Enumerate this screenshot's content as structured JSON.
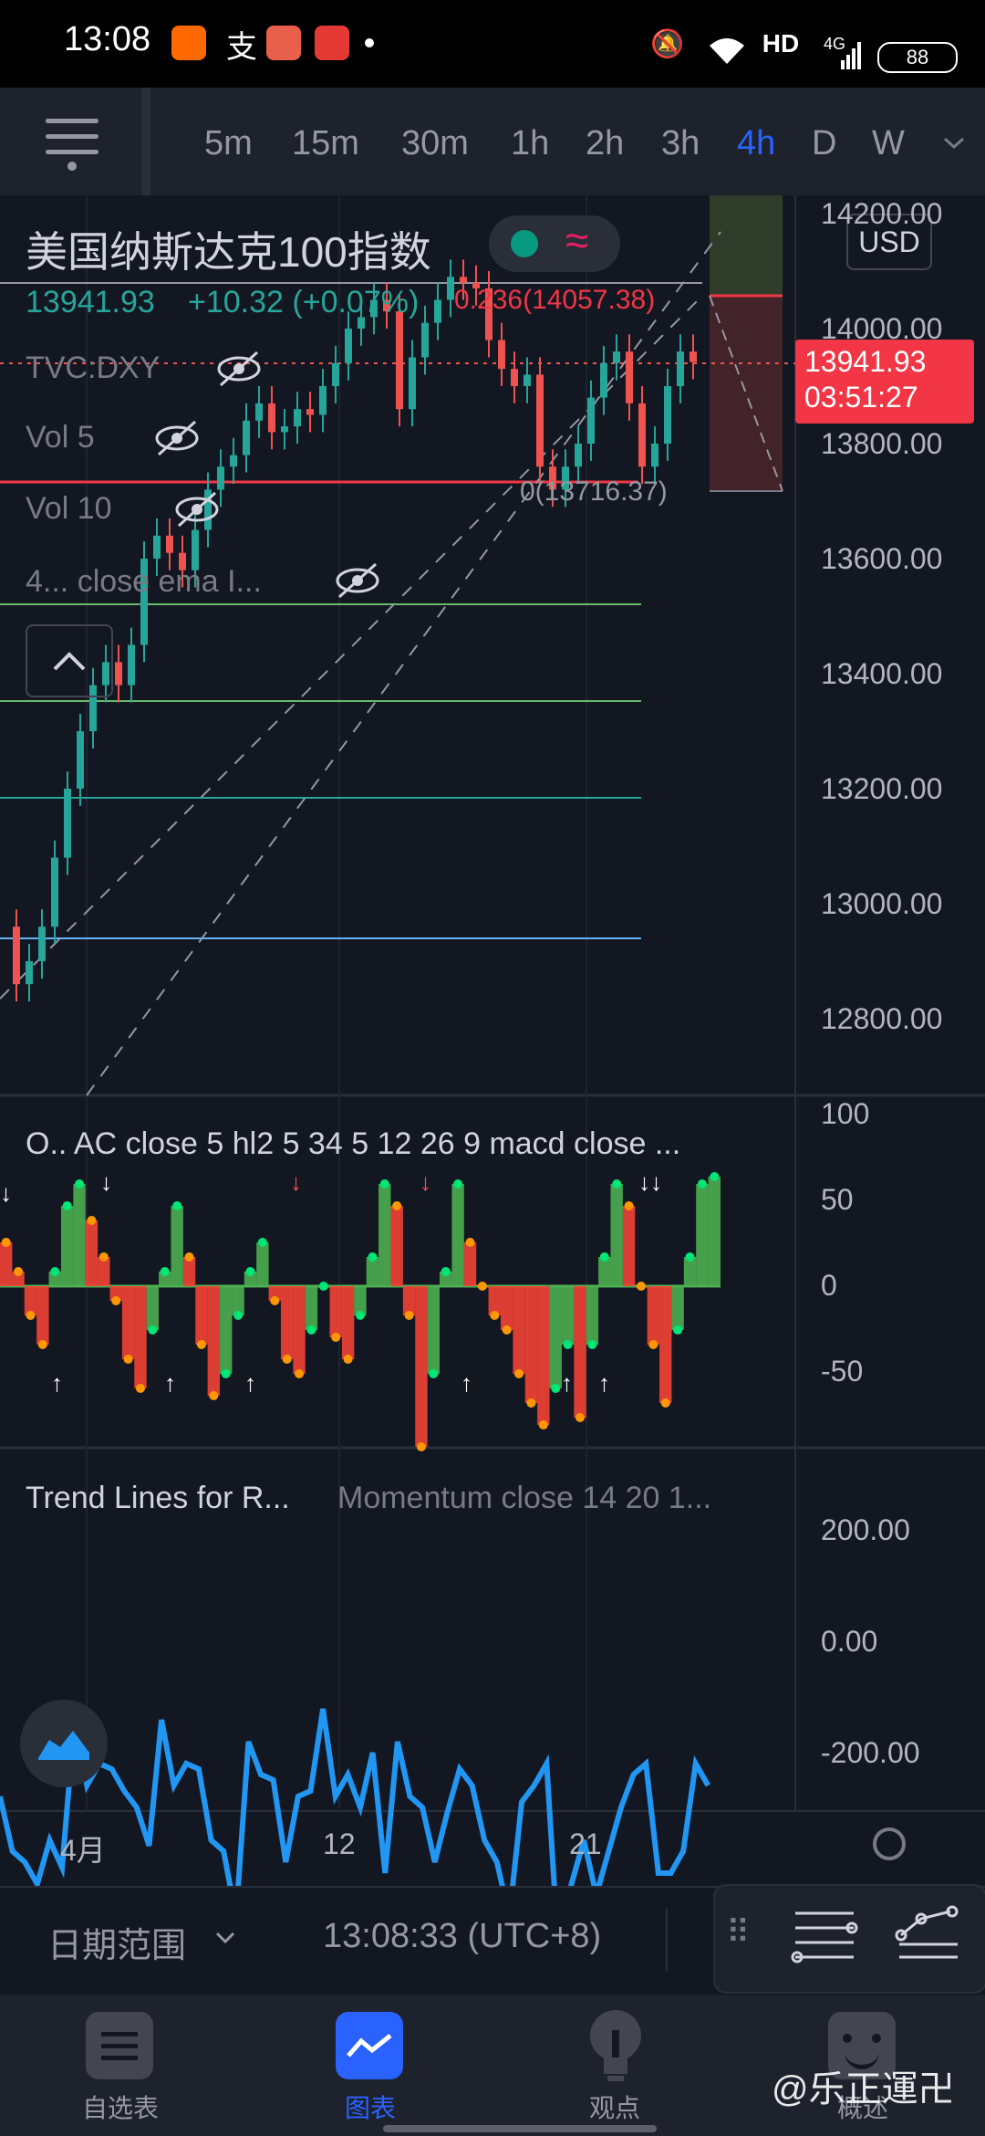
{
  "status": {
    "time": "13:08",
    "network": "HD",
    "signal": "4G",
    "battery": "88"
  },
  "toolbar": {
    "timeframes": [
      "5m",
      "15m",
      "30m",
      "1h",
      "2h",
      "3h",
      "4h",
      "D",
      "W"
    ],
    "active_timeframe": "4h"
  },
  "symbol": {
    "name": "美国纳斯达克100指数",
    "price": "13941.93",
    "change": "+10.32 (+0.07%)",
    "fib_top": "0.236(14057.38)",
    "fib_bottom": "0(13716.37)",
    "currency": "USD"
  },
  "indicators": {
    "overlay": [
      "TVC:DXY",
      "Vol 5",
      "Vol 10",
      "4... close ema I..."
    ],
    "oscillator_title": "O.. AC close 5 hl2 5 34 5 12 26 9 macd close ...",
    "momentum_title_left": "Trend Lines for R...",
    "momentum_title_right": "Momentum close 14 20 1..."
  },
  "price_axis": [
    "14200.00",
    "14000.00",
    "13800.00",
    "13600.00",
    "13400.00",
    "13200.00",
    "13000.00",
    "12800.00"
  ],
  "price_tag": {
    "price": "13941.93",
    "countdown": "03:51:27"
  },
  "osc_axis": [
    "100",
    "50",
    "0",
    "-50"
  ],
  "mom_axis": [
    "200.00",
    "0.00",
    "-200.00"
  ],
  "time_axis": [
    "4月",
    "12",
    "21"
  ],
  "footer": {
    "date_range": "日期范围",
    "clock": "13:08:33 (UTC+8)"
  },
  "nav": {
    "items": [
      "自选表",
      "图表",
      "观点",
      "概述"
    ],
    "active": "图表"
  },
  "watermark": "@乐正運卍",
  "colors": {
    "up": "#26a69a",
    "down": "#ef5350",
    "accent": "#2962ff",
    "fib_red": "#f23645",
    "momentum": "#2196f3"
  }
}
